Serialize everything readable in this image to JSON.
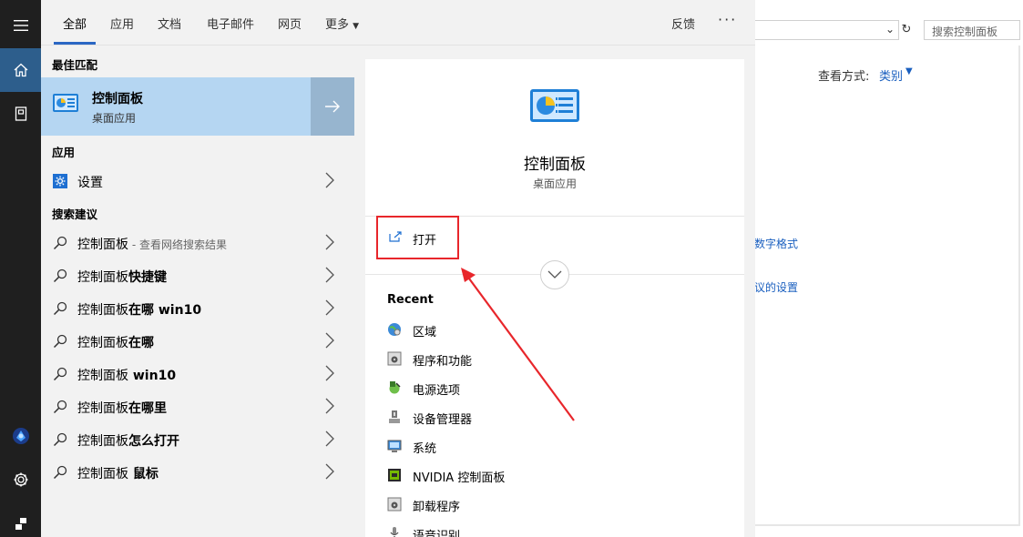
{
  "background": {
    "search_placeholder": "搜索控制面板",
    "view_by_label": "查看方式:",
    "view_by_value": "类别",
    "link_partial_1": "数字格式",
    "link_partial_2": "议的设置"
  },
  "tabs": [
    {
      "label": "全部",
      "active": true
    },
    {
      "label": "应用"
    },
    {
      "label": "文档"
    },
    {
      "label": "电子邮件"
    },
    {
      "label": "网页"
    },
    {
      "label": "更多"
    }
  ],
  "feedback_label": "反馈",
  "more_options": "···",
  "sections": {
    "best_match": "最佳匹配",
    "apps": "应用",
    "suggestions": "搜索建议"
  },
  "best_match": {
    "title": "控制面板",
    "subtitle": "桌面应用"
  },
  "apps": [
    {
      "label": "设置"
    }
  ],
  "suggestions": [
    {
      "prefix": "控制面板",
      "hint": " - 查看网络搜索结果",
      "suffix": ""
    },
    {
      "prefix": "控制面板",
      "hint": "",
      "suffix": "快捷键"
    },
    {
      "prefix": "控制面板",
      "hint": "",
      "suffix": "在哪 win10"
    },
    {
      "prefix": "控制面板",
      "hint": "",
      "suffix": "在哪"
    },
    {
      "prefix": "控制面板",
      "hint": "",
      "suffix": " win10"
    },
    {
      "prefix": "控制面板",
      "hint": "",
      "suffix": "在哪里"
    },
    {
      "prefix": "控制面板",
      "hint": "",
      "suffix": "怎么打开"
    },
    {
      "prefix": "控制面板",
      "hint": "",
      "suffix": " 鼠标"
    }
  ],
  "preview": {
    "title": "控制面板",
    "subtitle": "桌面应用",
    "open_label": "打开",
    "recent_heading": "Recent",
    "recent_items": [
      {
        "label": "区域",
        "icon": "globe-icon"
      },
      {
        "label": "程序和功能",
        "icon": "programs-icon"
      },
      {
        "label": "电源选项",
        "icon": "power-icon"
      },
      {
        "label": "设备管理器",
        "icon": "device-manager-icon"
      },
      {
        "label": "系统",
        "icon": "system-icon"
      },
      {
        "label": "NVIDIA 控制面板",
        "icon": "nvidia-icon"
      },
      {
        "label": "卸载程序",
        "icon": "uninstall-icon"
      },
      {
        "label": "语音识别",
        "icon": "microphone-icon"
      }
    ]
  },
  "colors": {
    "accent": "#2b67c4",
    "selected_bg": "#b5d6f2",
    "annotation_red": "#e8262b",
    "rail_bg": "#1f1f1f"
  }
}
